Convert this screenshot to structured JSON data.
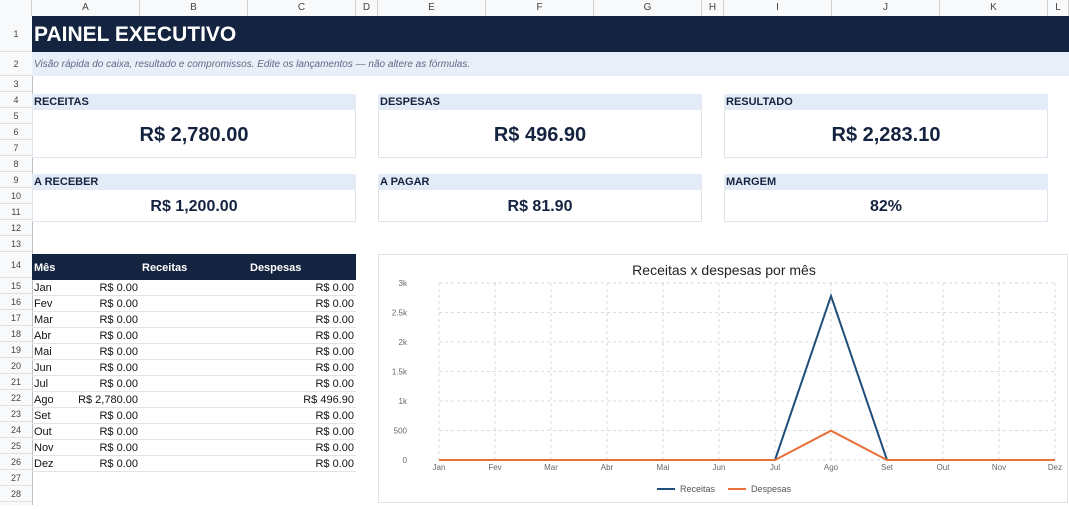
{
  "columns": [
    "A",
    "B",
    "C",
    "D",
    "E",
    "F",
    "G",
    "H",
    "I",
    "J",
    "K",
    "L"
  ],
  "rows": [
    "1",
    "2",
    "3",
    "4",
    "5",
    "6",
    "7",
    "8",
    "9",
    "10",
    "11",
    "12",
    "13",
    "14",
    "15",
    "16",
    "17",
    "18",
    "19",
    "20",
    "21",
    "22",
    "23",
    "24",
    "25",
    "26",
    "27",
    "28"
  ],
  "header": {
    "title": "PAINEL EXECUTIVO",
    "subtitle": "Visão rápida do caixa, resultado e compromissos. Edite os lançamentos — não altere as fórmulas."
  },
  "cards": {
    "receitas": {
      "label": "RECEITAS",
      "value": "R$ 2,780.00"
    },
    "despesas": {
      "label": "DESPESAS",
      "value": "R$ 496.90"
    },
    "resultado": {
      "label": "RESULTADO",
      "value": "R$ 2,283.10"
    },
    "a_receber": {
      "label": "A RECEBER",
      "value": "R$ 1,200.00"
    },
    "a_pagar": {
      "label": "A PAGAR",
      "value": "R$ 81.90"
    },
    "margem": {
      "label": "MARGEM",
      "value": "82%"
    }
  },
  "table": {
    "headers": [
      "Mês",
      "Receitas",
      "Despesas"
    ],
    "rows": [
      [
        "Jan",
        "R$ 0.00",
        "R$ 0.00"
      ],
      [
        "Fev",
        "R$ 0.00",
        "R$ 0.00"
      ],
      [
        "Mar",
        "R$ 0.00",
        "R$ 0.00"
      ],
      [
        "Abr",
        "R$ 0.00",
        "R$ 0.00"
      ],
      [
        "Mai",
        "R$ 0.00",
        "R$ 0.00"
      ],
      [
        "Jun",
        "R$ 0.00",
        "R$ 0.00"
      ],
      [
        "Jul",
        "R$ 0.00",
        "R$ 0.00"
      ],
      [
        "Ago",
        "R$ 2,780.00",
        "R$ 496.90"
      ],
      [
        "Set",
        "R$ 0.00",
        "R$ 0.00"
      ],
      [
        "Out",
        "R$ 0.00",
        "R$ 0.00"
      ],
      [
        "Nov",
        "R$ 0.00",
        "R$ 0.00"
      ],
      [
        "Dez",
        "R$ 0.00",
        "R$ 0.00"
      ]
    ]
  },
  "chart_data": {
    "type": "line",
    "title": "Receitas x despesas por mês",
    "categories": [
      "Jan",
      "Fev",
      "Mar",
      "Abr",
      "Mai",
      "Jun",
      "Jul",
      "Ago",
      "Set",
      "Out",
      "Nov",
      "Dez"
    ],
    "series": [
      {
        "name": "Receitas",
        "color": "#1f4e79",
        "values": [
          0,
          0,
          0,
          0,
          0,
          0,
          0,
          2780,
          0,
          0,
          0,
          0
        ]
      },
      {
        "name": "Despesas",
        "color": "#e8703a",
        "values": [
          0,
          0,
          0,
          0,
          0,
          0,
          0,
          496.9,
          0,
          0,
          0,
          0
        ]
      }
    ],
    "ylim": [
      0,
      3000
    ],
    "yticks": [
      0,
      500,
      1000,
      1500,
      2000,
      2500,
      3000
    ],
    "ytick_labels": [
      "0",
      "500",
      "1k",
      "1.5k",
      "2k",
      "2.5k",
      "3k"
    ],
    "grid": true,
    "legend": "bottom"
  }
}
